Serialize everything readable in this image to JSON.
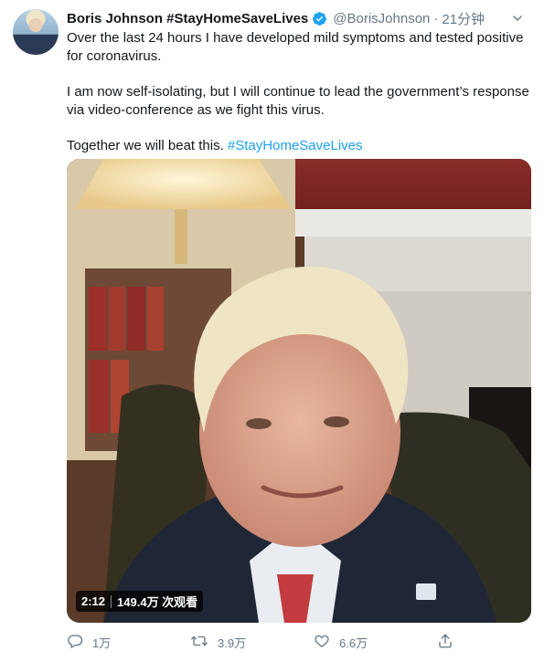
{
  "author": {
    "name": "Boris Johnson #StayHomeSaveLives",
    "handle": "@BorisJohnson",
    "separator": "·",
    "time": "21分钟",
    "verified": true
  },
  "tweet": {
    "paragraph1": "Over the last 24 hours I have developed mild symptoms and tested positive for coronavirus.",
    "paragraph2": "I am now self-isolating, but I will continue to lead the government’s response via video-conference as we fight this virus.",
    "paragraph3_text": "Together we will beat this. ",
    "paragraph3_hashtag": "#StayHomeSaveLives"
  },
  "video": {
    "duration": "2:12",
    "views": "149.4万 次观看"
  },
  "actions": {
    "reply_count": "1万",
    "retweet_count": "3.9万",
    "like_count": "6.6万"
  },
  "icons": {
    "verified": "verified-badge-icon",
    "caret": "chevron-down-icon",
    "reply": "reply-icon",
    "retweet": "retweet-icon",
    "like": "heart-icon",
    "share": "share-icon"
  },
  "colors": {
    "link": "#1da1f2",
    "muted": "#657786",
    "text": "#14171a"
  }
}
